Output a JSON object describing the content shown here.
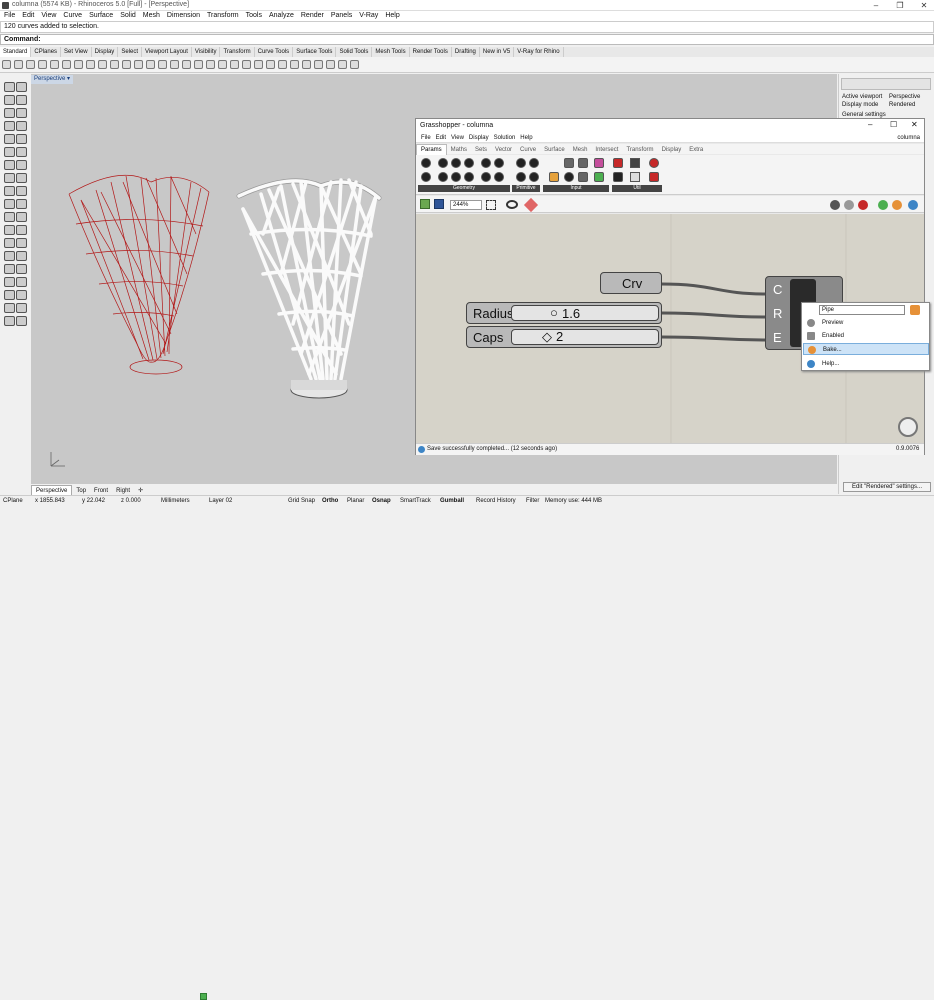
{
  "window": {
    "title": "columna (5574 KB) - Rhinoceros 5.0 [Full] - [Perspective]"
  },
  "menu": [
    "File",
    "Edit",
    "View",
    "Curve",
    "Surface",
    "Solid",
    "Mesh",
    "Dimension",
    "Transform",
    "Tools",
    "Analyze",
    "Render",
    "Panels",
    "V-Ray",
    "Help"
  ],
  "command": {
    "history": "120 curves added to selection.",
    "prompt": "Command:"
  },
  "toolbar_tabs": [
    "Standard",
    "CPlanes",
    "Set View",
    "Display",
    "Select",
    "Viewport Layout",
    "Visibility",
    "Transform",
    "Curve Tools",
    "Surface Tools",
    "Solid Tools",
    "Mesh Tools",
    "Render Tools",
    "Drafting",
    "New in V5",
    "V-Ray for Rhino"
  ],
  "viewport": {
    "name": "Perspective"
  },
  "right_panel": {
    "active_viewport_label": "Active viewport",
    "active_viewport_value": "Perspective",
    "display_mode_label": "Display mode",
    "display_mode_value": "Rendered",
    "section": "General settings",
    "edit_button": "Edit \"Rendered\" settings..."
  },
  "viewport_tabs": [
    "Perspective",
    "Top",
    "Front",
    "Right"
  ],
  "status": {
    "cplane": "CPlane",
    "x": "x 1855.843",
    "y": "y 22.042",
    "z": "z 0.000",
    "units": "Millimeters",
    "layer": "Layer 02",
    "grid_snap": "Grid Snap",
    "ortho": "Ortho",
    "planar": "Planar",
    "osnap": "Osnap",
    "smarttrack": "SmartTrack",
    "gumball": "Gumball",
    "record_history": "Record History",
    "filter": "Filter",
    "memory": "Memory use: 444 MB"
  },
  "gh": {
    "title": "Grasshopper - columna",
    "doc": "columna",
    "menu": [
      "File",
      "Edit",
      "View",
      "Display",
      "Solution",
      "Help"
    ],
    "tabs": [
      "Params",
      "Maths",
      "Sets",
      "Vector",
      "Curve",
      "Surface",
      "Mesh",
      "Intersect",
      "Transform",
      "Display",
      "Extra"
    ],
    "ribbon_groups": [
      "Geometry",
      "Primitive",
      "Input",
      "Util"
    ],
    "zoom": "244%",
    "status": "Save successfully completed... (12 seconds ago)",
    "version": "0.9.0076",
    "nodes": {
      "crv": "Crv",
      "radius": "Radius",
      "radius_value": "1.6",
      "caps": "Caps",
      "caps_value": "2",
      "inputs": [
        "C",
        "R",
        "E"
      ],
      "pipe": "Pipe"
    },
    "context_menu": {
      "name_value": "Pipe",
      "items": [
        "Preview",
        "Enabled",
        "Bake...",
        "Help..."
      ]
    }
  }
}
